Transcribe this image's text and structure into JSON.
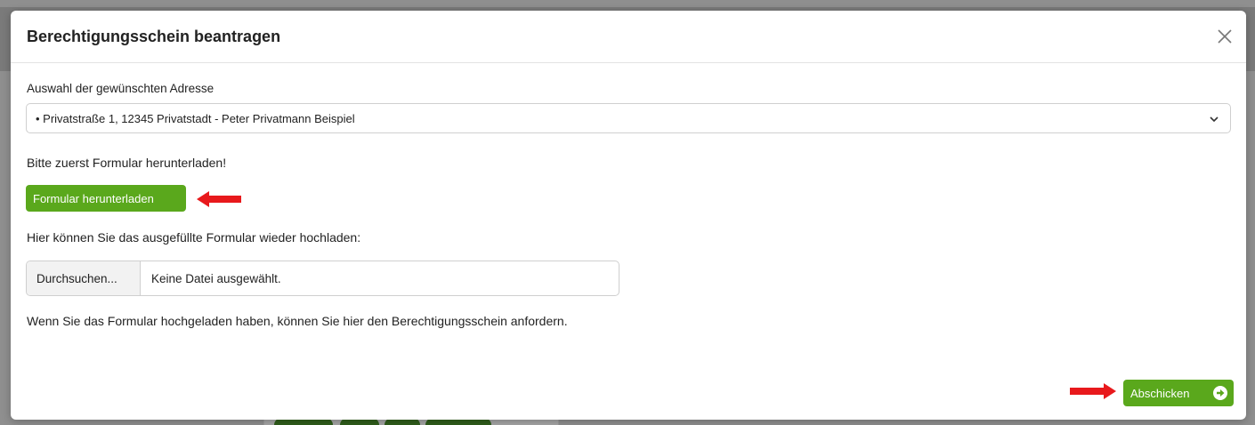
{
  "modal": {
    "title": "Berechtigungsschein beantragen"
  },
  "address": {
    "label": "Auswahl der gewünschten Adresse",
    "selected": "• Privatstraße 1, 12345 Privatstadt - Peter Privatmann Beispiel"
  },
  "download": {
    "instruction": "Bitte zuerst Formular herunterladen!",
    "button_label": "Formular herunterladen"
  },
  "upload": {
    "instruction": "Hier können Sie das ausgefüllte Formular wieder hochladen:",
    "browse_label": "Durchsuchen...",
    "status": "Keine Datei ausgewählt."
  },
  "request": {
    "instruction": "Wenn Sie das Formular hochgeladen haben, können Sie hier den Berechtigungsschein anfordern.",
    "submit_label": "Abschicken"
  },
  "colors": {
    "accent": "#5aa81c",
    "annotation_arrow": "#e8191c"
  },
  "icons": {
    "close": "close-icon",
    "chevron": "chevron-down-icon",
    "submit": "arrow-right-circle-icon",
    "annotation": "red-arrow-icon"
  }
}
